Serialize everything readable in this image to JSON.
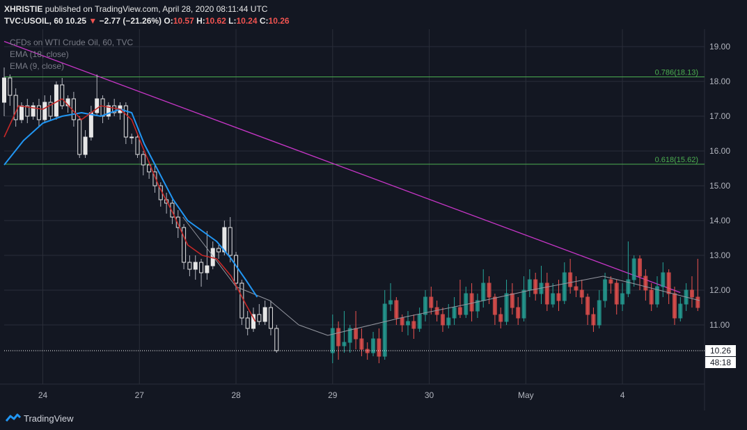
{
  "header": {
    "author": "XHRISTIE",
    "published_text": "published on TradingView.com, April 28, 2020 08:11:44 UTC",
    "symbol": "TVC:USOIL, 60",
    "last": "10.25",
    "arrow": "▼",
    "change": "−2.77 (−21.26%)",
    "o_label": "O:",
    "o_value": "10.57",
    "h_label": "H:",
    "h_value": "10.62",
    "l_label": "L:",
    "l_value": "10.24",
    "c_label": "C:",
    "c_value": "10.26"
  },
  "legend": {
    "title": "CFDs on WTI Crude Oil, 60, TVC",
    "ema18": "EMA (18, close)",
    "ema9": "EMA (9, close)"
  },
  "footer": {
    "brand": "TradingView"
  },
  "colors": {
    "background": "#131722",
    "grid": "#2a2e39",
    "up": "#26a69a",
    "down": "#ef5350",
    "ema18": "#2196f3",
    "ema9": "#c62828",
    "trendline": "#c836c8",
    "fib": "#4caf50"
  },
  "chart_data": {
    "type": "candlestick",
    "y_ticks": [
      "19.00",
      "18.00",
      "17.00",
      "16.00",
      "15.00",
      "14.00",
      "13.00",
      "12.00",
      "11.00"
    ],
    "ylim": [
      9.3,
      19.5
    ],
    "x_ticks": [
      {
        "label": "24",
        "t": 0.4
      },
      {
        "label": "27",
        "t": 1.4
      },
      {
        "label": "28",
        "t": 2.4
      },
      {
        "label": "29",
        "t": 3.4
      },
      {
        "label": "30",
        "t": 4.4
      },
      {
        "label": "May",
        "t": 5.4
      },
      {
        "label": "4",
        "t": 6.4
      }
    ],
    "xlim": [
      0,
      7.0
    ],
    "price_label": "10.26",
    "countdown": "48:18",
    "fib_levels": [
      {
        "label": "0.786(18.13)",
        "value": 18.13
      },
      {
        "label": "0.618(15.62)",
        "value": 15.62
      }
    ],
    "trendline": [
      [
        0.0,
        19.15
      ],
      [
        7.0,
        11.93
      ]
    ],
    "candles": [
      [
        0.0,
        17.4,
        18.1,
        18.4,
        17.0
      ],
      [
        0.06,
        18.1,
        17.6,
        18.2,
        17.3
      ],
      [
        0.12,
        17.6,
        16.9,
        17.8,
        16.7
      ],
      [
        0.18,
        16.9,
        17.3,
        17.4,
        16.8
      ],
      [
        0.24,
        17.3,
        17.0,
        17.5,
        16.8
      ],
      [
        0.3,
        17.0,
        17.3,
        17.4,
        16.9
      ],
      [
        0.36,
        17.3,
        16.9,
        17.5,
        16.7
      ],
      [
        0.42,
        16.9,
        17.4,
        17.6,
        16.8
      ],
      [
        0.48,
        17.4,
        17.0,
        17.6,
        16.9
      ],
      [
        0.54,
        17.0,
        17.9,
        18.0,
        16.9
      ],
      [
        0.6,
        17.9,
        17.3,
        18.1,
        17.2
      ],
      [
        0.66,
        17.3,
        17.5,
        17.6,
        17.1
      ],
      [
        0.72,
        17.5,
        16.9,
        17.7,
        16.7
      ],
      [
        0.78,
        16.9,
        15.9,
        17.0,
        15.8
      ],
      [
        0.84,
        15.9,
        16.4,
        16.6,
        15.8
      ],
      [
        0.9,
        16.4,
        17.1,
        17.3,
        16.3
      ],
      [
        0.96,
        17.1,
        17.5,
        18.2,
        17.0
      ],
      [
        1.02,
        17.5,
        17.0,
        17.6,
        16.8
      ],
      [
        1.08,
        17.0,
        17.3,
        17.4,
        16.9
      ],
      [
        1.14,
        17.3,
        17.1,
        17.5,
        17.0
      ],
      [
        1.2,
        17.1,
        17.3,
        17.4,
        16.9
      ],
      [
        1.26,
        17.3,
        16.4,
        17.4,
        16.2
      ],
      [
        1.32,
        16.4,
        16.4,
        16.5,
        16.2
      ],
      [
        1.38,
        16.4,
        15.9,
        16.5,
        15.8
      ],
      [
        1.44,
        15.9,
        15.6,
        16.0,
        15.3
      ],
      [
        1.5,
        15.6,
        15.4,
        15.7,
        15.2
      ],
      [
        1.56,
        15.4,
        15.0,
        15.6,
        14.8
      ],
      [
        1.62,
        15.0,
        14.6,
        15.1,
        14.4
      ],
      [
        1.68,
        14.6,
        14.5,
        14.8,
        14.2
      ],
      [
        1.74,
        14.5,
        14.1,
        14.6,
        13.9
      ],
      [
        1.8,
        14.1,
        13.8,
        14.3,
        13.5
      ],
      [
        1.86,
        13.8,
        12.8,
        13.9,
        12.6
      ],
      [
        1.92,
        12.8,
        12.6,
        13.0,
        12.4
      ],
      [
        1.98,
        12.6,
        12.8,
        13.0,
        12.3
      ],
      [
        2.04,
        12.8,
        12.5,
        12.9,
        12.1
      ],
      [
        2.1,
        12.5,
        12.7,
        13.7,
        12.3
      ],
      [
        2.16,
        12.7,
        13.2,
        13.4,
        12.6
      ],
      [
        2.22,
        13.2,
        13.1,
        13.3,
        12.9
      ],
      [
        2.28,
        13.1,
        13.8,
        14.0,
        13.0
      ],
      [
        2.34,
        13.8,
        13.0,
        14.1,
        12.8
      ],
      [
        2.4,
        13.0,
        12.2,
        13.1,
        12.0
      ],
      [
        2.46,
        12.2,
        11.2,
        12.3,
        11.0
      ],
      [
        2.52,
        11.2,
        10.9,
        11.4,
        10.7
      ],
      [
        2.58,
        10.9,
        11.3,
        11.5,
        10.8
      ],
      [
        2.64,
        11.3,
        11.1,
        11.6,
        11.0
      ],
      [
        2.7,
        11.1,
        11.5,
        11.7,
        11.0
      ],
      [
        2.76,
        11.5,
        10.9,
        11.7,
        10.7
      ],
      [
        2.82,
        10.9,
        10.26,
        11.0,
        10.2
      ],
      [
        3.4,
        10.2,
        10.9,
        11.3,
        9.9
      ],
      [
        3.46,
        10.9,
        10.4,
        11.1,
        10.0
      ],
      [
        3.52,
        10.4,
        10.5,
        11.4,
        10.2
      ],
      [
        3.58,
        10.5,
        10.9,
        11.0,
        10.2
      ],
      [
        3.64,
        10.9,
        10.6,
        11.4,
        10.3
      ],
      [
        3.7,
        10.6,
        10.3,
        10.9,
        10.1
      ],
      [
        3.76,
        10.3,
        10.2,
        10.5,
        10.0
      ],
      [
        3.82,
        10.2,
        10.6,
        10.8,
        10.1
      ],
      [
        3.88,
        10.6,
        10.1,
        10.9,
        9.9
      ],
      [
        3.94,
        10.1,
        11.6,
        12.0,
        10.0
      ],
      [
        4.0,
        11.6,
        11.7,
        12.2,
        11.4
      ],
      [
        4.06,
        11.7,
        11.2,
        11.8,
        11.0
      ],
      [
        4.12,
        11.2,
        11.0,
        11.3,
        10.8
      ],
      [
        4.18,
        11.0,
        11.1,
        11.4,
        10.7
      ],
      [
        4.24,
        11.1,
        10.9,
        11.3,
        10.6
      ],
      [
        4.3,
        10.9,
        11.3,
        11.5,
        10.8
      ],
      [
        4.36,
        11.3,
        11.8,
        12.0,
        11.1
      ],
      [
        4.42,
        11.8,
        11.5,
        12.1,
        11.3
      ],
      [
        4.48,
        11.5,
        11.3,
        11.7,
        11.1
      ],
      [
        4.54,
        11.3,
        11.0,
        11.5,
        10.8
      ],
      [
        4.6,
        11.0,
        11.2,
        11.6,
        10.9
      ],
      [
        4.66,
        11.2,
        11.5,
        11.8,
        11.0
      ],
      [
        4.72,
        11.5,
        11.3,
        12.3,
        11.2
      ],
      [
        4.78,
        11.3,
        11.9,
        12.1,
        11.2
      ],
      [
        4.84,
        11.9,
        11.4,
        12.2,
        11.1
      ],
      [
        4.9,
        11.4,
        11.7,
        11.9,
        11.2
      ],
      [
        4.96,
        11.7,
        12.2,
        12.6,
        11.5
      ],
      [
        5.02,
        12.2,
        11.8,
        12.4,
        11.6
      ],
      [
        5.08,
        11.8,
        11.3,
        11.9,
        11.0
      ],
      [
        5.14,
        11.3,
        11.1,
        11.5,
        10.9
      ],
      [
        5.2,
        11.1,
        11.9,
        12.3,
        11.0
      ],
      [
        5.26,
        11.9,
        11.5,
        12.2,
        11.3
      ],
      [
        5.32,
        11.5,
        11.2,
        11.8,
        11.0
      ],
      [
        5.38,
        11.2,
        12.0,
        12.4,
        11.1
      ],
      [
        5.44,
        12.0,
        12.3,
        12.6,
        11.8
      ],
      [
        5.5,
        12.3,
        11.9,
        12.5,
        11.7
      ],
      [
        5.56,
        11.9,
        12.2,
        12.7,
        11.6
      ],
      [
        5.62,
        12.2,
        11.6,
        12.5,
        11.4
      ],
      [
        5.68,
        11.6,
        11.9,
        12.2,
        11.5
      ],
      [
        5.74,
        11.9,
        11.7,
        12.3,
        11.4
      ],
      [
        5.8,
        11.7,
        12.5,
        12.8,
        11.6
      ],
      [
        5.86,
        12.5,
        12.1,
        12.9,
        11.9
      ],
      [
        5.92,
        12.1,
        12.0,
        12.4,
        11.8
      ],
      [
        5.98,
        12.0,
        11.8,
        12.3,
        11.6
      ],
      [
        6.04,
        11.8,
        11.3,
        11.9,
        11.0
      ],
      [
        6.1,
        11.3,
        11.0,
        11.5,
        10.8
      ],
      [
        6.16,
        11.0,
        11.7,
        12.0,
        10.9
      ],
      [
        6.22,
        11.7,
        12.3,
        12.5,
        11.5
      ],
      [
        6.28,
        12.3,
        12.2,
        12.4,
        11.9
      ],
      [
        6.34,
        12.2,
        11.6,
        12.3,
        11.3
      ],
      [
        6.4,
        11.6,
        11.9,
        12.2,
        11.4
      ],
      [
        6.46,
        11.9,
        12.3,
        13.4,
        11.8
      ],
      [
        6.52,
        12.3,
        12.9,
        13.0,
        12.1
      ],
      [
        6.58,
        12.9,
        12.4,
        13.0,
        12.0
      ],
      [
        6.64,
        12.4,
        12.0,
        12.6,
        11.7
      ],
      [
        6.7,
        12.0,
        11.6,
        12.2,
        11.4
      ],
      [
        6.76,
        11.6,
        12.1,
        12.4,
        11.5
      ],
      [
        6.82,
        12.1,
        12.5,
        12.8,
        11.8
      ],
      [
        6.88,
        12.5,
        11.9,
        12.6,
        11.6
      ],
      [
        6.94,
        11.9,
        11.2,
        12.1,
        11.0
      ],
      [
        7.0,
        11.2,
        11.6,
        11.8,
        11.1
      ],
      [
        7.06,
        11.6,
        12.0,
        12.2,
        11.4
      ],
      [
        7.12,
        12.0,
        11.8,
        12.4,
        11.5
      ],
      [
        7.18,
        11.8,
        11.5,
        12.9,
        11.4
      ]
    ],
    "ema18": [
      [
        0.0,
        15.6
      ],
      [
        0.2,
        16.3
      ],
      [
        0.4,
        16.8
      ],
      [
        0.6,
        17.0
      ],
      [
        0.8,
        17.1
      ],
      [
        1.0,
        17.0
      ],
      [
        1.2,
        17.2
      ],
      [
        1.32,
        17.1
      ],
      [
        1.45,
        16.2
      ],
      [
        1.6,
        15.4
      ],
      [
        1.75,
        14.6
      ],
      [
        1.9,
        14.0
      ],
      [
        2.05,
        13.7
      ],
      [
        2.2,
        13.4
      ],
      [
        2.35,
        12.9
      ],
      [
        2.5,
        12.3
      ],
      [
        2.62,
        11.8
      ]
    ],
    "ema9": [
      [
        0.0,
        16.4
      ],
      [
        0.15,
        17.3
      ],
      [
        0.4,
        17.2
      ],
      [
        0.6,
        17.5
      ],
      [
        0.8,
        16.9
      ],
      [
        1.0,
        17.3
      ],
      [
        1.2,
        17.2
      ],
      [
        1.32,
        16.9
      ],
      [
        1.45,
        16.0
      ],
      [
        1.6,
        15.0
      ],
      [
        1.75,
        14.2
      ],
      [
        1.9,
        13.3
      ],
      [
        2.05,
        13.0
      ],
      [
        2.2,
        12.9
      ],
      [
        2.35,
        12.4
      ],
      [
        2.5,
        11.6
      ],
      [
        2.6,
        11.1
      ]
    ],
    "gray_path": [
      [
        1.85,
        14.1
      ],
      [
        2.1,
        13.2
      ],
      [
        2.4,
        12.1
      ],
      [
        2.75,
        11.7
      ],
      [
        3.05,
        11.0
      ],
      [
        3.35,
        10.7
      ],
      [
        4.1,
        11.2
      ],
      [
        4.8,
        11.6
      ],
      [
        5.45,
        12.0
      ],
      [
        6.2,
        12.4
      ],
      [
        6.5,
        12.2
      ],
      [
        7.2,
        11.7
      ]
    ]
  }
}
